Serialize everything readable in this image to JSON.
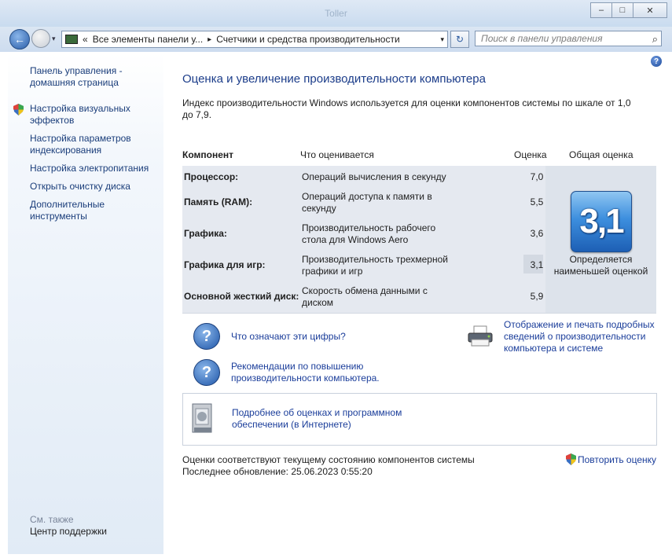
{
  "window": {
    "title": "Toller",
    "buttons": {
      "minimize": "–",
      "maximize": "□",
      "close": "✕"
    }
  },
  "address_bar": {
    "chevron": "«",
    "segments": [
      "Все элементы панели у...",
      "Счетчики и средства производительности"
    ],
    "separator": "▸",
    "dropdown": "▾",
    "refresh": "↻",
    "search_placeholder": "Поиск в панели управления",
    "search_icon": "⌕"
  },
  "sidebar": {
    "links": [
      "Панель управления - домашняя страница",
      "Настройка визуальных эффектов",
      "Настройка параметров индексирования",
      "Настройка электропитания",
      "Открыть очистку диска",
      "Дополнительные инструменты"
    ],
    "see_also_label": "См. также",
    "see_also_links": [
      "Центр поддержки"
    ]
  },
  "main": {
    "help": "?",
    "heading": "Оценка и увеличение производительности компьютера",
    "description": "Индекс производительности Windows используется для оценки компонентов системы по шкале от 1,0 до 7,9.",
    "table": {
      "headers": {
        "component": "Компонент",
        "assessed": "Что оценивается",
        "score": "Оценка",
        "overall": "Общая оценка"
      },
      "rows": [
        {
          "component": "Процессор:",
          "assessed": "Операций вычисления в секунду",
          "score": "7,0"
        },
        {
          "component": "Память (RAM):",
          "assessed": "Операций доступа к памяти в секунду",
          "score": "5,5"
        },
        {
          "component": "Графика:",
          "assessed": "Производительность рабочего стола для Windows Aero",
          "score": "3,6"
        },
        {
          "component": "Графика для игр:",
          "assessed": "Производительность трехмерной графики и игр",
          "score": "3,1"
        },
        {
          "component": "Основной жесткий диск:",
          "assessed": "Скорость обмена данными с диском",
          "score": "5,9"
        }
      ],
      "overall_score": "3,1",
      "overall_note": "Определяется наименьшей оценкой"
    },
    "links": {
      "what_numbers_mean": "Что означают эти цифры?",
      "improve_tips": "Рекомендации по повышению производительности компьютера.",
      "print_details": "Отображение и печать подробных сведений о производительности компьютера и системе",
      "online_info": "Подробнее об оценках и программном обеспечении (в Интернете)"
    },
    "status_line": "Оценки соответствуют текущему состоянию компонентов системы",
    "last_update": "Последнее обновление: 25.06.2023 0:55:20",
    "rerun_label": "Повторить оценку"
  },
  "colors": {
    "link": "#1a3d9a",
    "heading": "#1c3d8a",
    "badge": "#3d8fde",
    "sidebar_bg": "#e1ebf6",
    "table_bg": "#e5e9f0"
  }
}
